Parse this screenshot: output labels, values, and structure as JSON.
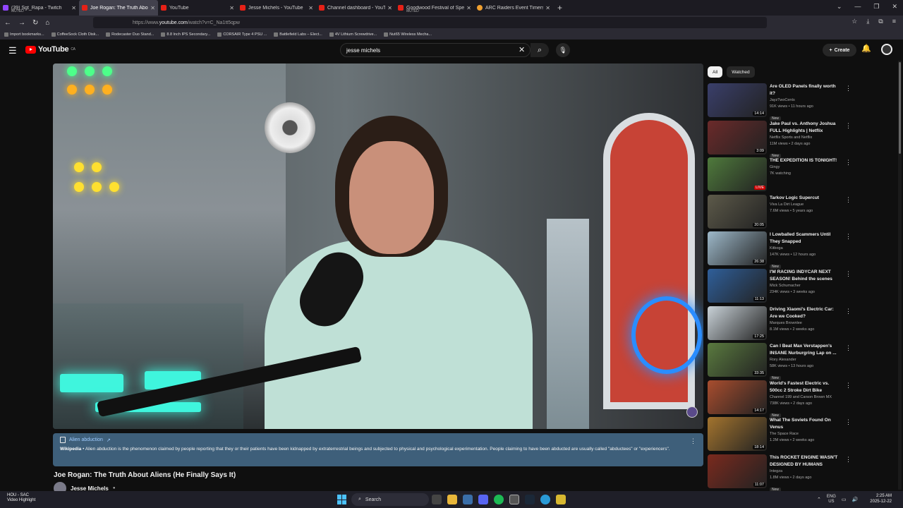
{
  "browser": {
    "tabs": [
      {
        "title": "(39) Sgt_Rapa - Twitch",
        "sub": "MUTED",
        "icon": "twitch-icon"
      },
      {
        "title": "Joe Rogan: The Truth About Ali",
        "sub": "",
        "icon": "youtube-icon",
        "active": true
      },
      {
        "title": "YouTube",
        "sub": "",
        "icon": "youtube-icon"
      },
      {
        "title": "Jesse Michels - YouTube",
        "sub": "",
        "icon": "youtube-icon"
      },
      {
        "title": "Channel dashboard - YouTube",
        "sub": "",
        "icon": "youtube-icon"
      },
      {
        "title": "Goodwood Festival of Speed -",
        "sub": "MUTED",
        "icon": "youtube-icon"
      },
      {
        "title": "ARC Raiders Event Timers | Me",
        "sub": "",
        "icon": "arc-icon"
      }
    ],
    "new_tab": "+",
    "url_prefix": "https://www.",
    "url_domain": "youtube.com",
    "url_path": "/watch?v=C_Na1tt5qpw",
    "bookmarks": [
      "Import bookmarks...",
      "CoffeeSock Cloth Disk...",
      "Rodecaster Duo Stand...",
      "8.8 Inch IPS Secondary...",
      "CORSAIR Type 4 PSU ...",
      "Battlefield Labs – Elect...",
      "4V Lithium Screwdrive...",
      "Nut65 Wireless Mecha..."
    ]
  },
  "youtube": {
    "logo_text": "YouTube",
    "logo_region": "CA",
    "search_value": "jesse michels",
    "create_label": "Create",
    "info_panel": {
      "title": "Alien abduction",
      "source": "Wikipedia",
      "text": " • Alien abduction is the phenomenon claimed by people reporting that they or their patients have been kidnapped by extraterrestrial beings and subjected to physical and psychological experimentation. People claiming to have been abducted are usually called \"abductees\" or \"experiencers\"."
    },
    "video_title": "Joe Rogan: The Truth About Aliens (He Finally Says It)",
    "channel_name": "Jesse Michels",
    "chips": [
      "All",
      "Watched"
    ],
    "recommendations": [
      {
        "title": "Are OLED Panels finally worth it?",
        "channel": "JayzTwoCents",
        "views": "91K views • 11 hours ago",
        "badge": "New",
        "duration": "14:14",
        "thumb": "#3a3f6b"
      },
      {
        "title": "Jake Paul vs. Anthony Joshua FULL Highlights | Netflix",
        "channel": "Netflix Sports and Netflix",
        "views": "11M views • 2 days ago",
        "badge": "New",
        "duration": "3:09",
        "thumb": "#6b2a2a"
      },
      {
        "title": "THE EXPEDITION IS TONIGHT!",
        "channel": "Gingy",
        "views": "7K watching",
        "badge": "",
        "duration": "LIVE",
        "thumb": "#4f7a3c"
      },
      {
        "title": "Tarkov Logic Supercut",
        "channel": "Viva La Dirt League",
        "views": "7.6M views • 5 years ago",
        "badge": "",
        "duration": "20:05",
        "thumb": "#5d5a4a"
      },
      {
        "title": "I Lowballed Scammers Until They Snapped",
        "channel": "Kitboga",
        "views": "147K views • 12 hours ago",
        "badge": "New",
        "duration": "26:38",
        "thumb": "#9db8c9"
      },
      {
        "title": "I'M RACING INDYCAR NEXT SEASON! Behind the scenes at...",
        "channel": "Mick Schumacher",
        "views": "234K views • 3 weeks ago",
        "badge": "",
        "duration": "11:13",
        "thumb": "#2f5f9a"
      },
      {
        "title": "Driving Xiaomi's Electric Car: Are we Cooked?",
        "channel": "Marques Brownlee",
        "views": "8.1M views • 2 weeks ago",
        "badge": "",
        "duration": "17:25",
        "thumb": "#c9d2d8"
      },
      {
        "title": "Can I Beat Max Verstappen's INSANE Nurburgring Lap on ...",
        "channel": "Rory Alexander",
        "views": "58K views • 13 hours ago",
        "badge": "New",
        "duration": "33:35",
        "thumb": "#5a7a3f"
      },
      {
        "title": "World's Fastest Electric vs. 500cc 2 Stroke Dirt Bike",
        "channel": "Channel 199 and Carson Brown MX",
        "views": "738K views • 2 days ago",
        "badge": "New",
        "duration": "14:17",
        "thumb": "#a84d2e"
      },
      {
        "title": "What The Soviets Found On Venus",
        "channel": "The Space Race",
        "views": "1.2M views • 2 weeks ago",
        "badge": "",
        "duration": "18:14",
        "thumb": "#a3742e"
      },
      {
        "title": "This ROCKET ENGINE WASN'T DESIGNED BY HUMANS",
        "channel": "Integza",
        "views": "1.8M views • 2 days ago",
        "badge": "New",
        "duration": "11:07",
        "thumb": "#7a2a1e"
      }
    ]
  },
  "taskbar": {
    "weather_title": "HOU - SAC",
    "weather_sub": "Video Highlight",
    "search_label": "Search",
    "lang": "ENG",
    "region": "US",
    "time": "2:25 AM",
    "date": "2025-12-22"
  }
}
